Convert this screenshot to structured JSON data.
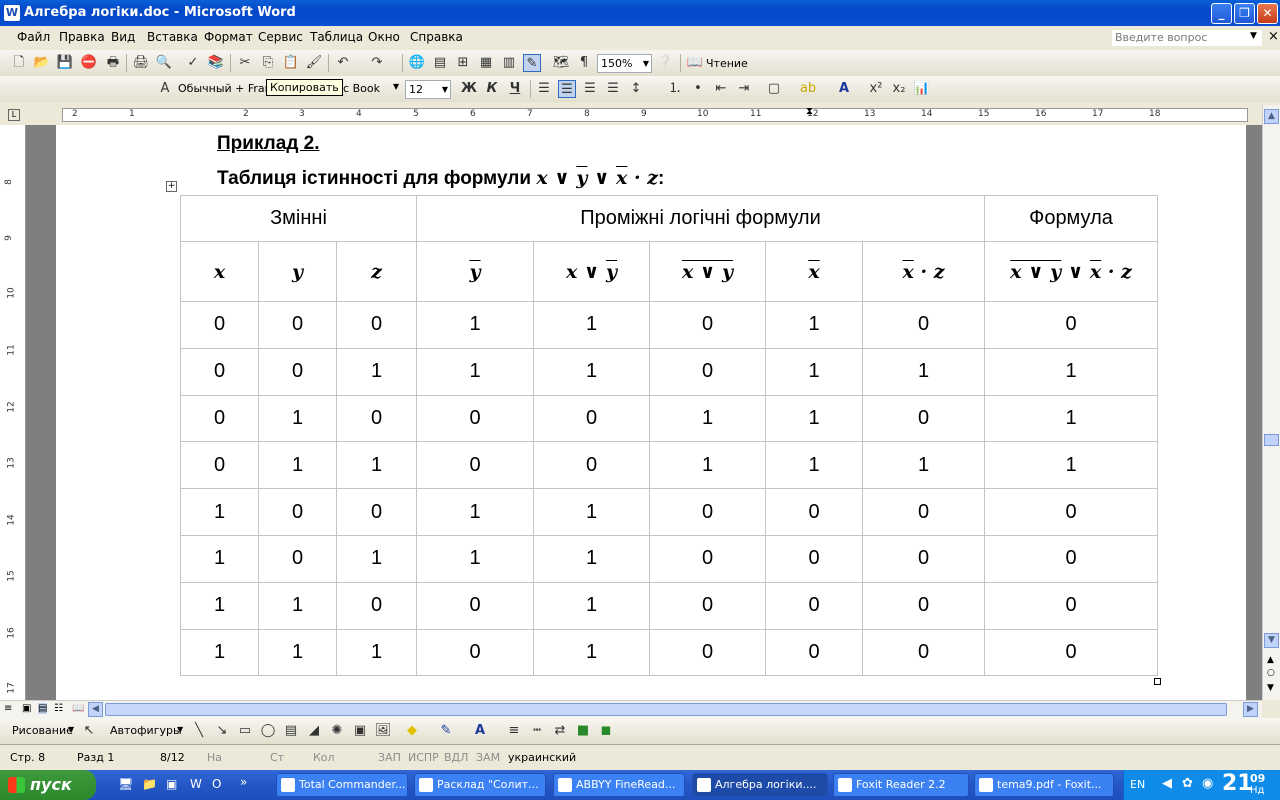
{
  "window": {
    "title": "Алгебра логіки.doc - Microsoft Word",
    "app_icon": "W"
  },
  "menu": {
    "items": [
      "Файл",
      "Правка",
      "Вид",
      "Вставка",
      "Формат",
      "Сервис",
      "Таблица",
      "Окно",
      "Справка"
    ],
    "question_placeholder": "Введите вопрос"
  },
  "toolbar_standard": {
    "zoom": "150%",
    "read_label": "Чтение"
  },
  "toolbar_format": {
    "style": "Обычный + Fran",
    "font": "hic Book",
    "size": "12"
  },
  "tooltip": "Копировать",
  "ruler": {
    "h_numbers": [
      "2",
      "1",
      "",
      "1",
      "2",
      "3",
      "4",
      "5",
      "6",
      "7",
      "8",
      "9",
      "10",
      "11",
      "12",
      "13",
      "14",
      "15",
      "16",
      "17",
      "18"
    ],
    "v_numbers": [
      "8",
      "9",
      "10",
      "11",
      "12",
      "13",
      "14",
      "15",
      "16",
      "17"
    ]
  },
  "document": {
    "heading": "Приклад 2.",
    "subheading_prefix": "Таблиця істинності для формули ",
    "subheading_suffix": ":",
    "table": {
      "group_headers": [
        "Змінні",
        "Проміжні логічні формули",
        "Формула"
      ],
      "rows": [
        [
          "0",
          "0",
          "0",
          "1",
          "1",
          "0",
          "1",
          "0",
          "0"
        ],
        [
          "0",
          "0",
          "1",
          "1",
          "1",
          "0",
          "1",
          "1",
          "1"
        ],
        [
          "0",
          "1",
          "0",
          "0",
          "0",
          "1",
          "1",
          "0",
          "1"
        ],
        [
          "0",
          "1",
          "1",
          "0",
          "0",
          "1",
          "1",
          "1",
          "1"
        ],
        [
          "1",
          "0",
          "0",
          "1",
          "1",
          "0",
          "0",
          "0",
          "0"
        ],
        [
          "1",
          "0",
          "1",
          "1",
          "1",
          "0",
          "0",
          "0",
          "0"
        ],
        [
          "1",
          "1",
          "0",
          "0",
          "1",
          "0",
          "0",
          "0",
          "0"
        ],
        [
          "1",
          "1",
          "1",
          "0",
          "1",
          "0",
          "0",
          "0",
          "0"
        ]
      ]
    }
  },
  "drawing_toolbar": {
    "draw_label": "Рисование",
    "autoshapes_label": "Автофигуры"
  },
  "status": {
    "page": "Стр. 8",
    "section": "Разд 1",
    "pages": "8/12",
    "at": "На",
    "line": "Ст",
    "col": "Кол",
    "rec": "ЗАП",
    "trk": "ИСПР",
    "ext": "ВДЛ",
    "ovr": "ЗАМ",
    "lang": "украинский"
  },
  "taskbar": {
    "start": "пуск",
    "tasks": [
      "Total Commander...",
      "Расклад \"Солит...",
      "ABBYY FineRead...",
      "Алгебра логіки....",
      "Foxit Reader 2.2",
      "tema9.pdf - Foxit..."
    ],
    "lang": "EN",
    "time": "21",
    "time_min": "09",
    "day": "Нд"
  }
}
